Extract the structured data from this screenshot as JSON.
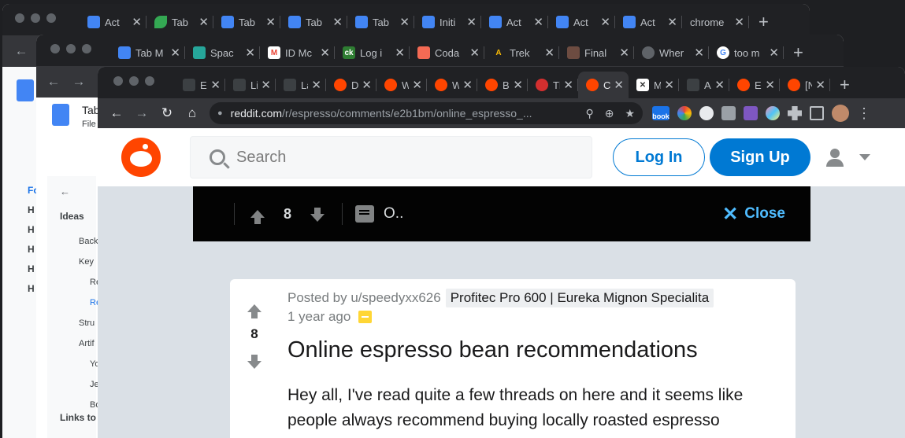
{
  "window_back": {
    "tabs": [
      {
        "title": "Act",
        "icon": "gdoc"
      },
      {
        "title": "Tab",
        "icon": "leaf"
      },
      {
        "title": "Tab",
        "icon": "gdoc"
      },
      {
        "title": "Tab",
        "icon": "gdoc"
      },
      {
        "title": "Tab",
        "icon": "gdoc"
      },
      {
        "title": "Initi",
        "icon": "gdoc"
      },
      {
        "title": "Act",
        "icon": "gdoc"
      },
      {
        "title": "Act",
        "icon": "gdoc"
      },
      {
        "title": "Act",
        "icon": "gdoc"
      },
      {
        "title": "chrome",
        "icon": "none"
      }
    ],
    "sidebar_text": [
      "Fo",
      "H",
      "H",
      "H",
      "H",
      "H"
    ]
  },
  "window_middle": {
    "tabs": [
      {
        "title": "Tab M",
        "icon": "gdoc"
      },
      {
        "title": "Spac",
        "icon": "teal"
      },
      {
        "title": "ID Mc",
        "icon": "gmail"
      },
      {
        "title": "Log i",
        "icon": "ck"
      },
      {
        "title": "Coda",
        "icon": "coda"
      },
      {
        "title": "Trek",
        "icon": "trek"
      },
      {
        "title": "Final",
        "icon": "img"
      },
      {
        "title": "Wher",
        "icon": "grey"
      },
      {
        "title": "too m",
        "icon": "google"
      }
    ],
    "doc_title": "Tab",
    "doc_file_menu": "File",
    "outline": {
      "heading": "Ideas",
      "items": [
        "Back",
        "Key",
        "Re",
        "Re",
        "Stru",
        "Artif",
        "Yo",
        "Je",
        "Bo"
      ],
      "footer": "Links to"
    }
  },
  "window_front": {
    "tabs": [
      {
        "title": "Espr",
        "icon": "dark"
      },
      {
        "title": "List",
        "icon": "dark"
      },
      {
        "title": "La M",
        "icon": "dark"
      },
      {
        "title": "Doe",
        "icon": "reddit"
      },
      {
        "title": "Wha",
        "icon": "reddit"
      },
      {
        "title": "Wha",
        "icon": "reddit"
      },
      {
        "title": "Bea",
        "icon": "reddit"
      },
      {
        "title": "The",
        "icon": "lips"
      },
      {
        "title": "C",
        "icon": "reddit",
        "active": true
      },
      {
        "title": "Midr",
        "icon": "x"
      },
      {
        "title": "Any",
        "icon": "dark"
      },
      {
        "title": "Espr",
        "icon": "reddit"
      },
      {
        "title": "[Nev",
        "icon": "reddit"
      }
    ],
    "url_domain": "reddit.com",
    "url_path": "/r/espresso/comments/e2b1bm/online_espresso_...",
    "extension_badge": "book"
  },
  "reddit": {
    "search_placeholder": "Search",
    "login_label": "Log In",
    "signup_label": "Sign Up",
    "bar": {
      "score": "8",
      "comments_label": "O..",
      "close_label": "Close"
    },
    "post": {
      "posted_by": "Posted by u/speedyxx626",
      "flair": "Profitec Pro 600 | Eureka Mignon Specialita",
      "age": "1 year ago",
      "score": "8",
      "title": "Online espresso bean recommendations",
      "body": "Hey all, I've read quite a few threads on here and it seems like people always recommend buying locally roasted espresso"
    }
  },
  "colors": {
    "reddit_orange": "#ff4500",
    "reddit_blue": "#0079d3",
    "close_blue": "#4fbcff",
    "chrome_dark": "#35363a"
  }
}
